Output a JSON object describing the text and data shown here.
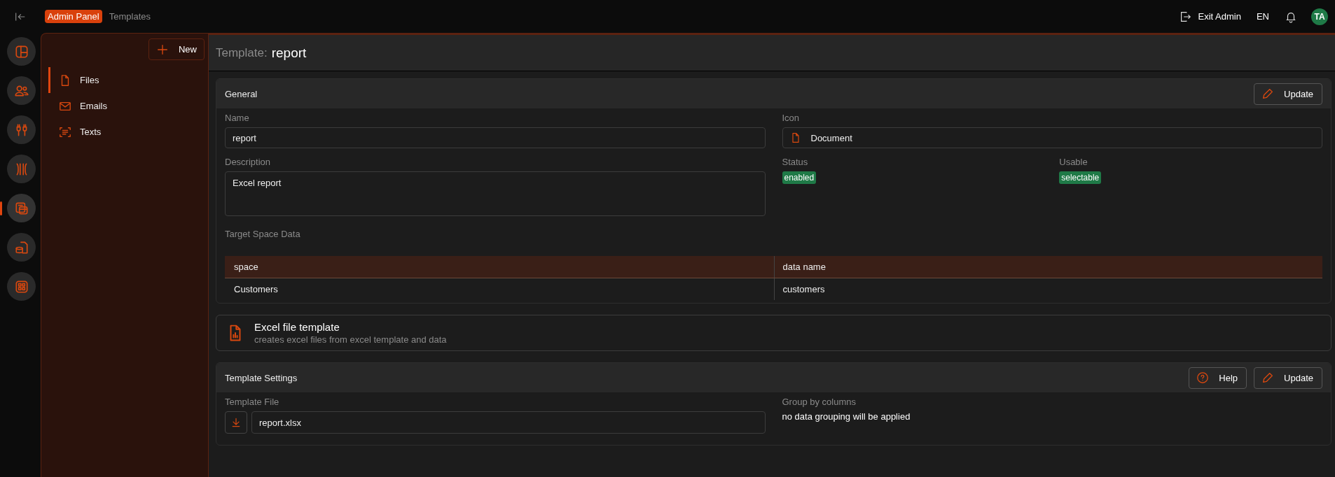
{
  "header": {
    "breadcrumbs": [
      {
        "label": "Admin Panel",
        "kind": "badge"
      },
      {
        "label": "Templates",
        "kind": "link"
      }
    ],
    "exit_button": "Exit Admin",
    "language": "EN",
    "avatar": "TA"
  },
  "rail": {
    "items": [
      {
        "selected": false
      },
      {
        "selected": false
      },
      {
        "selected": false
      },
      {
        "selected": false
      },
      {
        "selected": true
      },
      {
        "selected": false
      },
      {
        "selected": false
      }
    ]
  },
  "sidebar": {
    "new_button": "New",
    "items": [
      {
        "label": "Files",
        "selected": true
      },
      {
        "label": "Emails",
        "selected": false
      },
      {
        "label": "Texts",
        "selected": false
      }
    ]
  },
  "page_title": {
    "prefix": "Template:",
    "name": "report"
  },
  "general": {
    "title": "General",
    "update_button": "Update",
    "name": {
      "label": "Name",
      "value": "report"
    },
    "icon": {
      "label": "Icon",
      "value": "Document"
    },
    "description": {
      "label": "Description",
      "value": "Excel report"
    },
    "status": {
      "label": "Status",
      "badge": "enabled"
    },
    "usable": {
      "label": "Usable",
      "badge": "selectable"
    },
    "target_label": "Target Space Data",
    "table": {
      "columns": [
        "space",
        "data name"
      ],
      "rows": [
        [
          "Customers",
          "customers"
        ]
      ]
    }
  },
  "template_type": {
    "title": "Excel file template",
    "description": "creates excel files from excel template and data"
  },
  "settings": {
    "title": "Template Settings",
    "help_button": "Help",
    "update_button": "Update",
    "file": {
      "label": "Template File",
      "value": "report.xlsx"
    },
    "group": {
      "label": "Group by columns",
      "value": "no data grouping will be applied"
    }
  }
}
